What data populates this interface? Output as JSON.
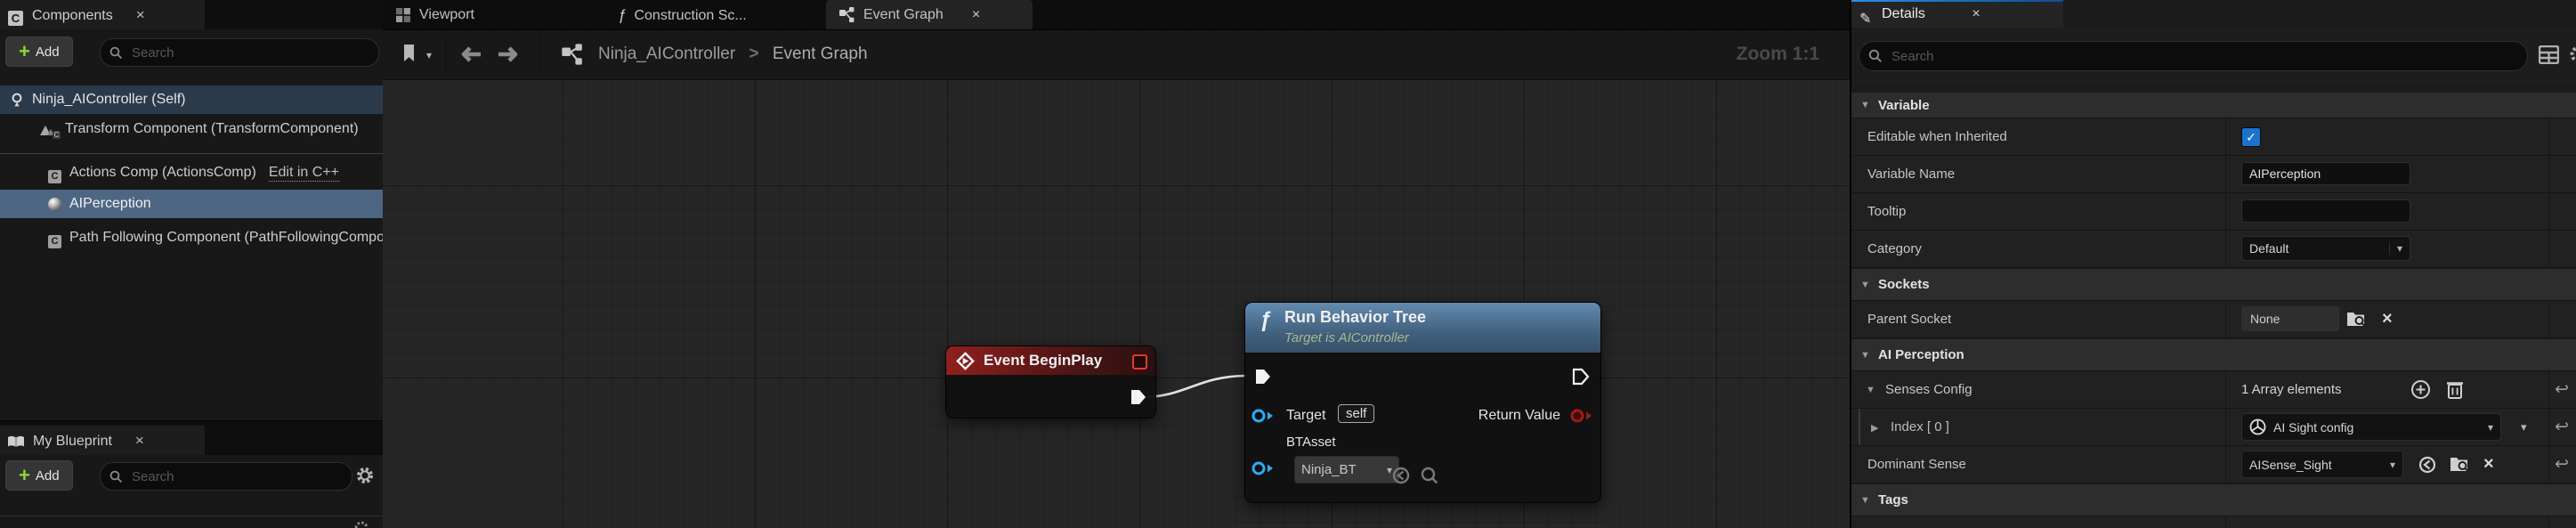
{
  "glyphs": {
    "add": "+",
    "close": "×",
    "function": "ƒ",
    "component_letter": "C",
    "chevron_down": "▾",
    "expander_open": "▼",
    "expander_closed": "▶",
    "breadcrumb_sep": ">",
    "check": "✓",
    "reset": "↩",
    "pencil": "✎"
  },
  "components": {
    "tab_label": "Components",
    "add_label": "Add",
    "search_placeholder": "Search",
    "rows": [
      {
        "label": "Ninja_AIController (Self)"
      },
      {
        "label": "Transform Component (TransformComponent)"
      },
      {
        "label": "Actions Comp (ActionsComp)",
        "link_label": "Edit in C++"
      },
      {
        "label": "AIPerception"
      },
      {
        "label": "Path Following Component (PathFollowingComponent)"
      }
    ]
  },
  "my_blueprint": {
    "tab_label": "My Blueprint",
    "add_label": "Add",
    "search_placeholder": "Search"
  },
  "graph": {
    "tabs": {
      "viewport": "Viewport",
      "construction": "Construction Sc...",
      "event_graph": "Event Graph"
    },
    "breadcrumb": {
      "root": "Ninja_AIController",
      "current": "Event Graph"
    },
    "zoom_label": "Zoom 1:1",
    "begin_play": {
      "title": "Event BeginPlay"
    },
    "run_behavior_tree": {
      "title": "Run Behavior Tree",
      "subtitle": "Target is AIController",
      "target_label": "Target",
      "target_value": "self",
      "btasset_label": "BTAsset",
      "btasset_value": "Ninja_BT",
      "return_label": "Return Value"
    }
  },
  "details": {
    "tab_label": "Details",
    "search_placeholder": "Search",
    "sections": {
      "variable": "Variable",
      "sockets": "Sockets",
      "ai_perception": "AI Perception",
      "tags": "Tags"
    },
    "editable_when_inherited": {
      "label": "Editable when Inherited",
      "checked": true
    },
    "variable_name": {
      "label": "Variable Name",
      "value": "AIPerception"
    },
    "tooltip": {
      "label": "Tooltip",
      "value": ""
    },
    "category": {
      "label": "Category",
      "value": "Default"
    },
    "parent_socket": {
      "label": "Parent Socket",
      "value": "None"
    },
    "senses_config": {
      "label": "Senses Config",
      "value": "1 Array elements"
    },
    "sense_index": {
      "label": "Index [ 0 ]",
      "value": "AI Sight config"
    },
    "dominant_sense": {
      "label": "Dominant Sense",
      "value": "AISense_Sight"
    }
  },
  "colors": {
    "accent_blue": "#2a8fe8",
    "selection_blue": "#4d6782",
    "checkbox_blue": "#1a73cf",
    "exec_pin": "#f2f2f2",
    "object_pin": "#2fa9f0",
    "bool_pin": "#a11a1a",
    "event_node_red": "#8f201f",
    "function_node_blue": "#628bb0",
    "add_green": "#8bd83a"
  }
}
